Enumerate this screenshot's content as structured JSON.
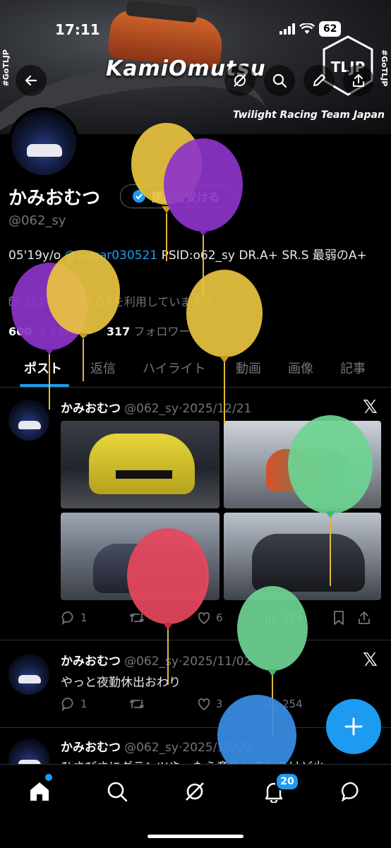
{
  "status_bar": {
    "time": "17:11",
    "battery": "62"
  },
  "banner": {
    "brand": "KamiOmutsu",
    "team": "Twilight Racing Team Japan",
    "side_tag_left": "#GoTLJP",
    "side_tag_right": "#GoTLJP",
    "logo_text": "TLJP"
  },
  "profile": {
    "name": "かみおむつ",
    "verify_button": "認証を受ける",
    "handle": "@062_sy",
    "bio_prefix": "05'19y/o ",
    "bio_mention": "@Sugar030521",
    "bio_suffix": " PSID:o62_sy DR.A+ SR.S 最弱のA+",
    "joined": "2024年3月からXを利用しています",
    "following_count": "600",
    "following_label": "フォロー中",
    "followers_count": "317",
    "followers_label": "フォロワー"
  },
  "tabs": [
    "ポスト",
    "返信",
    "ハイライト",
    "動画",
    "画像",
    "記事"
  ],
  "posts": [
    {
      "name": "かみおむつ",
      "handle": "@062_sy",
      "date": "2025/12/21",
      "text": "",
      "replies": "1",
      "retweets": "",
      "likes": "6",
      "views": "274"
    },
    {
      "name": "かみおむつ",
      "handle": "@062_sy",
      "date": "2025/11/02",
      "text": "やっと夜勤休出おわり",
      "replies": "1",
      "retweets": "",
      "likes": "3",
      "views": "254"
    },
    {
      "name": "かみおむつ",
      "handle": "@062_sy",
      "date": "2025/10/09",
      "text": "ひさびさにグランツやったら意外と走れるけど少",
      "replies": "",
      "retweets": "",
      "likes": "",
      "views": ""
    }
  ],
  "nav": {
    "notifications_badge": "20"
  },
  "colors": {
    "accent": "#1d9bf0",
    "background": "#000000",
    "muted": "#71767b"
  }
}
